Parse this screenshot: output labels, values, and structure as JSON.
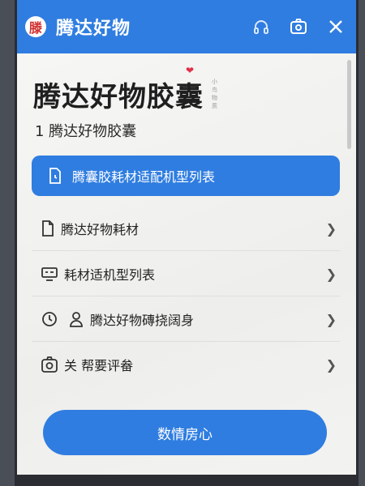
{
  "titlebar": {
    "logo_glyph": "滕",
    "title": "腾达好物",
    "icons": [
      "headset-icon",
      "camera-box-icon",
      "close-icon"
    ]
  },
  "hero": {
    "title": "腾达好物胶囊",
    "note": "小鸟物质"
  },
  "subtitle": "1 腾达好物胶囊",
  "primary_item": {
    "label": "腾囊胶耗材适配机型列表"
  },
  "menu": [
    {
      "label": "腾达好物耗材",
      "icon": "document-icon"
    },
    {
      "label": "耗材适机型列表",
      "icon": "monitor-icon"
    },
    {
      "label": "腾达好物磚挠阔身",
      "icon": "clock-icon",
      "icon2": "person-icon"
    },
    {
      "label": "关 帮要评畚",
      "icon": "camera-badge-icon"
    }
  ],
  "cta": {
    "label": "数情房心"
  },
  "colors": {
    "brand_blue": "#2f7de0",
    "background": "#f2f2f0",
    "heart": "#e0304a"
  }
}
